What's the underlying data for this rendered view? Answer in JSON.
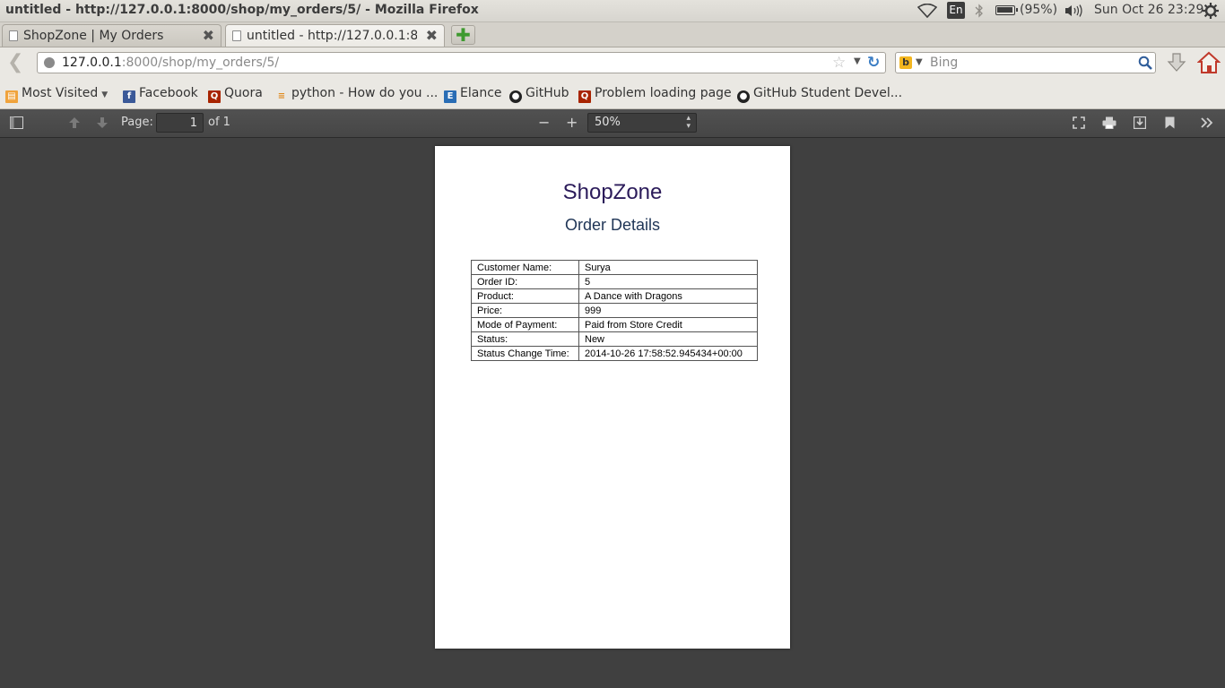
{
  "os": {
    "window_title": "untitled - http://127.0.0.1:8000/shop/my_orders/5/ - Mozilla Firefox",
    "keyboard_layout": "En",
    "battery": "(95%)",
    "datetime": "Sun Oct 26 23:29"
  },
  "tabs": [
    {
      "label": "ShopZone | My Orders",
      "active": false
    },
    {
      "label": "untitled - http://127.0.0.1:8...",
      "active": true
    }
  ],
  "navbar": {
    "url_host": "127.0.0.1",
    "url_rest": ":8000/shop/my_orders/5/",
    "search_placeholder": "Bing",
    "search_engine_icon": "b"
  },
  "bookmarks": [
    {
      "label": "Most Visited",
      "icon": "folder-icon",
      "has_dropdown": true
    },
    {
      "label": "Facebook",
      "icon": "facebook-icon"
    },
    {
      "label": "Quora",
      "icon": "quora-icon"
    },
    {
      "label": "python - How do you ...",
      "icon": "stackoverflow-icon"
    },
    {
      "label": "Elance",
      "icon": "elance-icon"
    },
    {
      "label": "GitHub",
      "icon": "github-icon"
    },
    {
      "label": "Problem loading page",
      "icon": "quora-icon"
    },
    {
      "label": "GitHub Student Devel...",
      "icon": "github-icon"
    }
  ],
  "pdf_toolbar": {
    "page_label": "Page:",
    "page_number": "1",
    "page_of": "of 1",
    "zoom": "50%"
  },
  "document": {
    "title": "ShopZone",
    "subtitle": "Order Details",
    "rows": [
      {
        "key": "Customer Name:",
        "value": "Surya"
      },
      {
        "key": "Order ID:",
        "value": "5"
      },
      {
        "key": "Product:",
        "value": "A Dance with Dragons"
      },
      {
        "key": "Price:",
        "value": "999"
      },
      {
        "key": "Mode of Payment:",
        "value": "Paid from Store Credit"
      },
      {
        "key": "Status:",
        "value": "New"
      },
      {
        "key": "Status Change Time:",
        "value": "2014-10-26 17:58:52.945434+00:00"
      }
    ]
  },
  "colors": {
    "pdf_background": "#404040",
    "doc_title": "#2b1b5a",
    "doc_subtitle": "#1f3556"
  }
}
